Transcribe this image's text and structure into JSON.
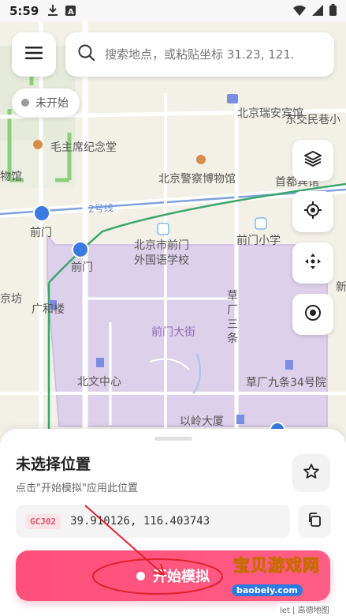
{
  "status_bar": {
    "time": "5:59",
    "icons_left": [
      "download-icon",
      "app-a-icon"
    ],
    "icons_right": [
      "wifi-icon",
      "signal-icon",
      "battery-icon"
    ]
  },
  "search": {
    "placeholder": "搜索地点，或粘贴坐标 31.23, 121."
  },
  "sim_status": {
    "label": "未开始",
    "dot_color": "#9a9a9a"
  },
  "map": {
    "labels": [
      "北京瑞安宾馆",
      "东交民巷小",
      "毛主席纪念堂",
      "物馆",
      "北京警察博物馆",
      "首都宾馆",
      "2号线",
      "前门",
      "北京市前门",
      "外国语学校",
      "前门小学",
      "广和楼",
      "京坊",
      "前门大街",
      "草厂三条",
      "北文中心",
      "草厂九条34号院",
      "以岭大厦",
      "新",
      "门"
    ]
  },
  "controls": [
    "layers-icon",
    "gps-locate-icon",
    "move-icon",
    "target-icon"
  ],
  "sheet": {
    "title": "未选择位置",
    "subtitle": "点击\"开始模拟\"应用此位置",
    "coord_system": "GCJ02",
    "coords": "39.910126, 116.403743",
    "start_label": "开始模拟"
  },
  "attribution": "let | 高德地图",
  "watermark": {
    "text": "宝贝游戏网",
    "url": "baobeiy.com"
  },
  "colors": {
    "accent": "#ff5780",
    "map_purple_area": "#ddd0ea",
    "map_green_line": "#3aa66a",
    "map_blue_line": "#6b8fd6"
  }
}
